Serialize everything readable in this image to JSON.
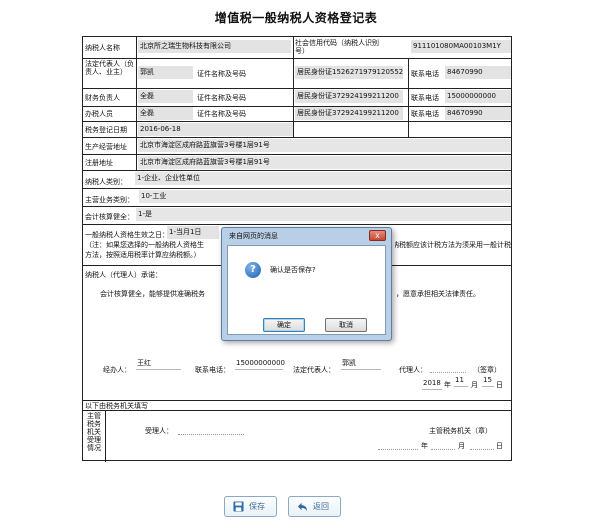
{
  "form": {
    "title": "增值税一般纳税人资格登记表",
    "taxpayer_name_label": "纳税人名称",
    "taxpayer_name": "北京所之瑞生物科技有限公司",
    "credit_code_label": "社会信用代码（纳税人识别号）",
    "credit_code": "911101080MA00103M1Y",
    "legal_rep_label": "法定代表人（负责人、业主）",
    "legal_rep_name": "郭凯",
    "id_type_label": "证件名称及号码",
    "id_value_legal": "居民身份证1526271979120552",
    "contact_phone_label": "联系电话",
    "phone_legal": "84670990",
    "finance_head_label": "财务负责人",
    "finance_head_name": "全磊",
    "id_value_finance": "居民身份证372924199211200",
    "phone_finance": "15000000000",
    "handler_label": "办税人员",
    "handler_name": "全磊",
    "id_value_handler": "居民身份证372924199211200",
    "phone_handler": "84670990",
    "reg_date_label": "税务登记日期",
    "reg_date": "2016-06-18",
    "biz_addr_label": "生产经营地址",
    "biz_addr": "北京市海淀区成府路蓝旗营3号楼1层91号",
    "reg_addr_label": "注册地址",
    "reg_addr": "北京市海淀区成府路蓝旗营3号楼1层91号",
    "category_label": "纳税人类别：",
    "category_value": "1-企业、企业性单位",
    "industry_label": "主营业务类别：",
    "industry_value": "10-工业",
    "accounting_label": "会计核算健全：",
    "accounting_value": "1-是",
    "effective_date_label": "一般纳税人资格生效之日：",
    "effective_date_value": "1-当月1日",
    "note_left": "（注：如果您选择的一般纳税人资格生",
    "note_left_2": "方法，按照适用税率计算应纳税额。）",
    "note_right": "期计税方法计算应纳税额的，应纳税额应该计税方法为须采用一般计税",
    "declaration_label": "纳税人（代理人）承诺：",
    "declaration_left": "会计核算健全，能够提供准确税务",
    "declaration_right": "，愿意承担相关法律责任。",
    "operator_label": "经办人：",
    "operator_value": "王红",
    "phone_label": "联系电话：",
    "phone_value": "15000000000",
    "legal_rep_sign_label": "法定代表人：",
    "legal_rep_sign_value": "郭凯",
    "agent_label": "代理人：",
    "stamp_label": "（签章）",
    "sign_year": "2018",
    "year_label": "年",
    "sign_month": "11",
    "month_label": "月",
    "sign_day": "15",
    "day_label": "日",
    "tax_office_section": "以下由税务机关填写",
    "tax_office_label": "主管税务机关受理情况",
    "receiver_label": "受理人：",
    "tax_office_stamp": "主管税务机关（章）",
    "blank_year": "年",
    "blank_month": "月",
    "blank_day": "日"
  },
  "buttons": {
    "save_label": "保存",
    "back_label": "返回"
  },
  "dialog": {
    "title": "来自网页的消息",
    "message": "确认是否保存?",
    "ok_label": "确定",
    "cancel_label": "取消",
    "close_symbol": "x"
  },
  "colors": {
    "field_bg": "#e3e3e3",
    "button_text": "#3a6a9a",
    "dialog_frame": "#b9cfe6"
  }
}
